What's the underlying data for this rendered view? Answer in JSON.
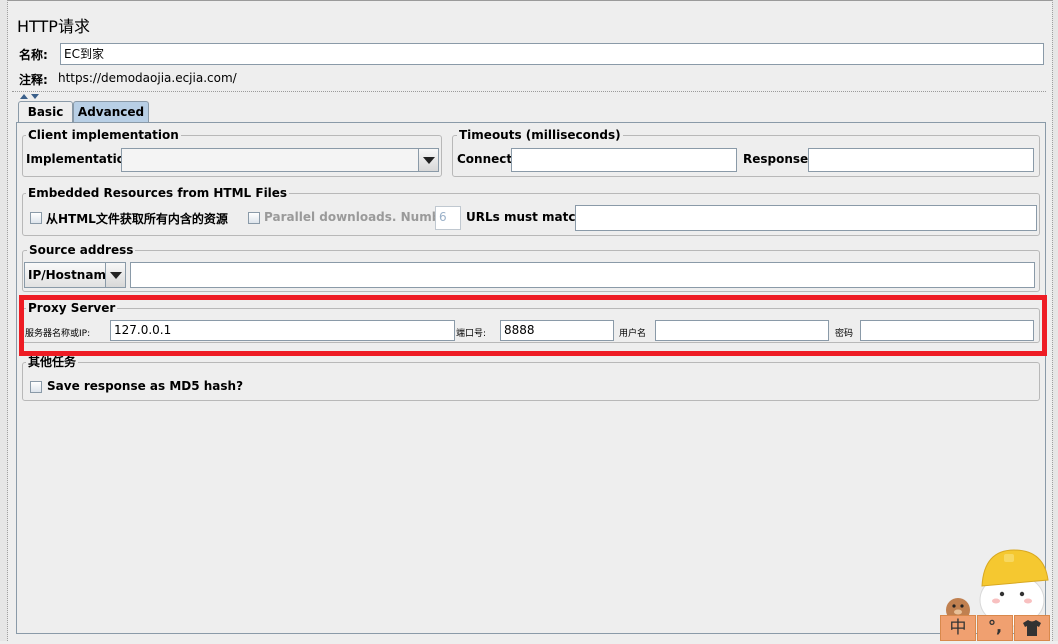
{
  "header": {
    "title": "HTTP请求",
    "name_label": "名称:",
    "name_value": "EC到家",
    "comment_label": "注释:",
    "comment_value": "https://demodaojia.ecjia.com/"
  },
  "tabs": [
    {
      "label": "Basic",
      "selected": false
    },
    {
      "label": "Advanced",
      "selected": true
    }
  ],
  "client_impl": {
    "title": "Client implementation",
    "impl_label": "Implementation:",
    "impl_value": ""
  },
  "timeouts": {
    "title": "Timeouts (milliseconds)",
    "connect_label": "Connect:",
    "connect_value": "",
    "response_label": "Response:",
    "response_value": ""
  },
  "embedded": {
    "title": "Embedded Resources from HTML Files",
    "retrieve_label": "从HTML文件获取所有内含的资源",
    "retrieve_checked": false,
    "parallel_label": "Parallel downloads. Number:",
    "parallel_checked": false,
    "parallel_value": "6",
    "urls_label": "URLs must match:",
    "urls_value": ""
  },
  "source": {
    "title": "Source address",
    "type_value": "IP/Hostname",
    "address_value": ""
  },
  "proxy": {
    "title": "Proxy Server",
    "server_label": "服务器名称或IP:",
    "server_value": "127.0.0.1",
    "port_label": "端口号:",
    "port_value": "8888",
    "user_label": "用户名",
    "user_value": "",
    "password_label": "密码",
    "password_value": ""
  },
  "other": {
    "title": "其他任务",
    "md5_label": "Save response as MD5 hash?",
    "md5_checked": false
  },
  "ime": {
    "lang": "中",
    "punct": "°,"
  },
  "colors": {
    "highlight": "#ee1c24",
    "tab_selected": "#b8cfe5",
    "ime_orange": "#f0a070"
  }
}
